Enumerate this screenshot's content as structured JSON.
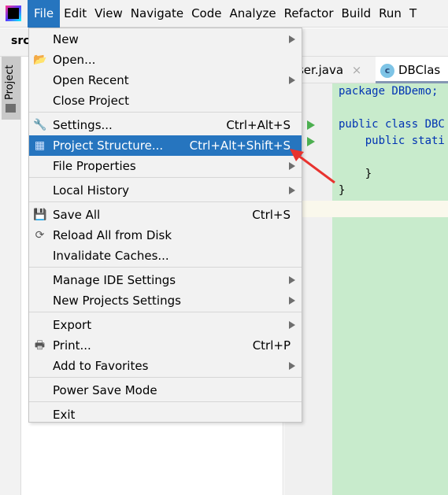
{
  "menubar": {
    "items": [
      "File",
      "Edit",
      "View",
      "Navigate",
      "Code",
      "Analyze",
      "Refactor",
      "Build",
      "Run",
      "T"
    ],
    "active": "File"
  },
  "breadcrumb": "src",
  "tool_window": {
    "project_label": "Project"
  },
  "editor": {
    "tabs": [
      {
        "label": "User.java"
      },
      {
        "label": "DBClas",
        "active": true
      }
    ],
    "code": [
      "package DBDemo;",
      "",
      "public class DBC",
      "    public stati",
      "",
      "    }",
      "}"
    ]
  },
  "file_menu": {
    "items": [
      {
        "label": "New",
        "submenu": true
      },
      {
        "label": "Open...",
        "icon": "folder-open-icon"
      },
      {
        "label": "Open Recent",
        "submenu": true
      },
      {
        "label": "Close Project"
      },
      {
        "separator": true
      },
      {
        "label": "Settings...",
        "shortcut": "Ctrl+Alt+S",
        "icon": "wrench-icon"
      },
      {
        "label": "Project Structure...",
        "shortcut": "Ctrl+Alt+Shift+S",
        "icon": "project-structure-icon",
        "selected": true
      },
      {
        "label": "File Properties",
        "submenu": true
      },
      {
        "separator": true
      },
      {
        "label": "Local History",
        "submenu": true
      },
      {
        "separator": true
      },
      {
        "label": "Save All",
        "shortcut": "Ctrl+S",
        "icon": "save-icon"
      },
      {
        "label": "Reload All from Disk",
        "icon": "reload-icon"
      },
      {
        "label": "Invalidate Caches..."
      },
      {
        "separator": true
      },
      {
        "label": "Manage IDE Settings",
        "submenu": true
      },
      {
        "label": "New Projects Settings",
        "submenu": true
      },
      {
        "separator": true
      },
      {
        "label": "Export",
        "submenu": true
      },
      {
        "label": "Print...",
        "shortcut": "Ctrl+P",
        "icon": "print-icon"
      },
      {
        "label": "Add to Favorites",
        "submenu": true
      },
      {
        "separator": true
      },
      {
        "label": "Power Save Mode"
      },
      {
        "separator": true
      },
      {
        "label": "Exit"
      }
    ]
  },
  "colors": {
    "accent": "#2675bf",
    "code_bg": "#c8ebcc",
    "annotation_arrow": "#e8332f"
  }
}
